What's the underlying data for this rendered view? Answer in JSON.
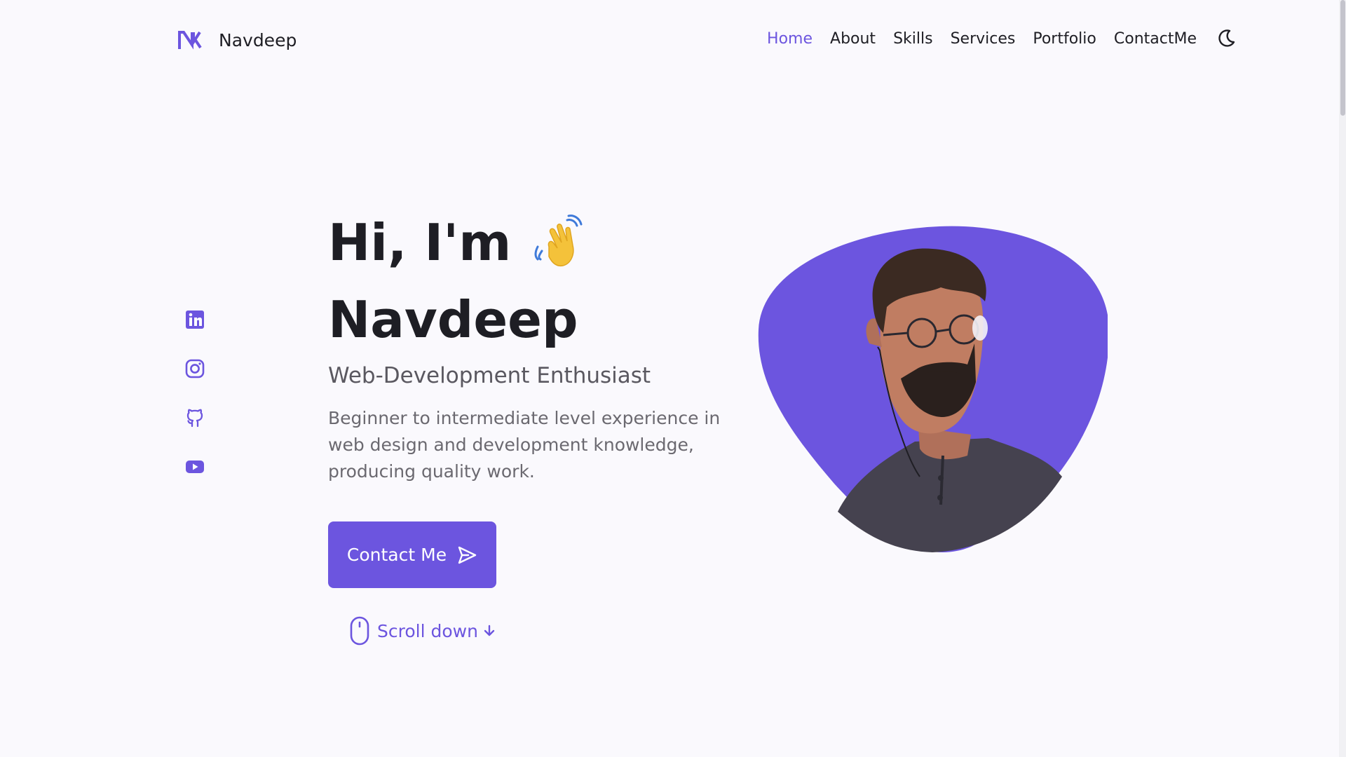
{
  "header": {
    "logo_text": "Navdeep",
    "nav": [
      {
        "label": "Home",
        "active": true
      },
      {
        "label": "About"
      },
      {
        "label": "Skills"
      },
      {
        "label": "Services"
      },
      {
        "label": "Portfolio"
      },
      {
        "label": "ContactMe"
      }
    ],
    "theme_icon": "moon-icon"
  },
  "socials": [
    "linkedin-icon",
    "instagram-icon",
    "github-icon",
    "youtube-icon"
  ],
  "hero": {
    "greeting": "Hi, I'm",
    "name": "Navdeep",
    "subtitle": "Web-Development Enthusiast",
    "description": "Beginner to intermediate level experience in web design and development knowledge, producing quality work.",
    "cta_label": "Contact Me",
    "scroll_label": "Scroll down"
  },
  "colors": {
    "accent": "#6c55df",
    "background": "#faf9fd",
    "text": "#1e1e24"
  }
}
